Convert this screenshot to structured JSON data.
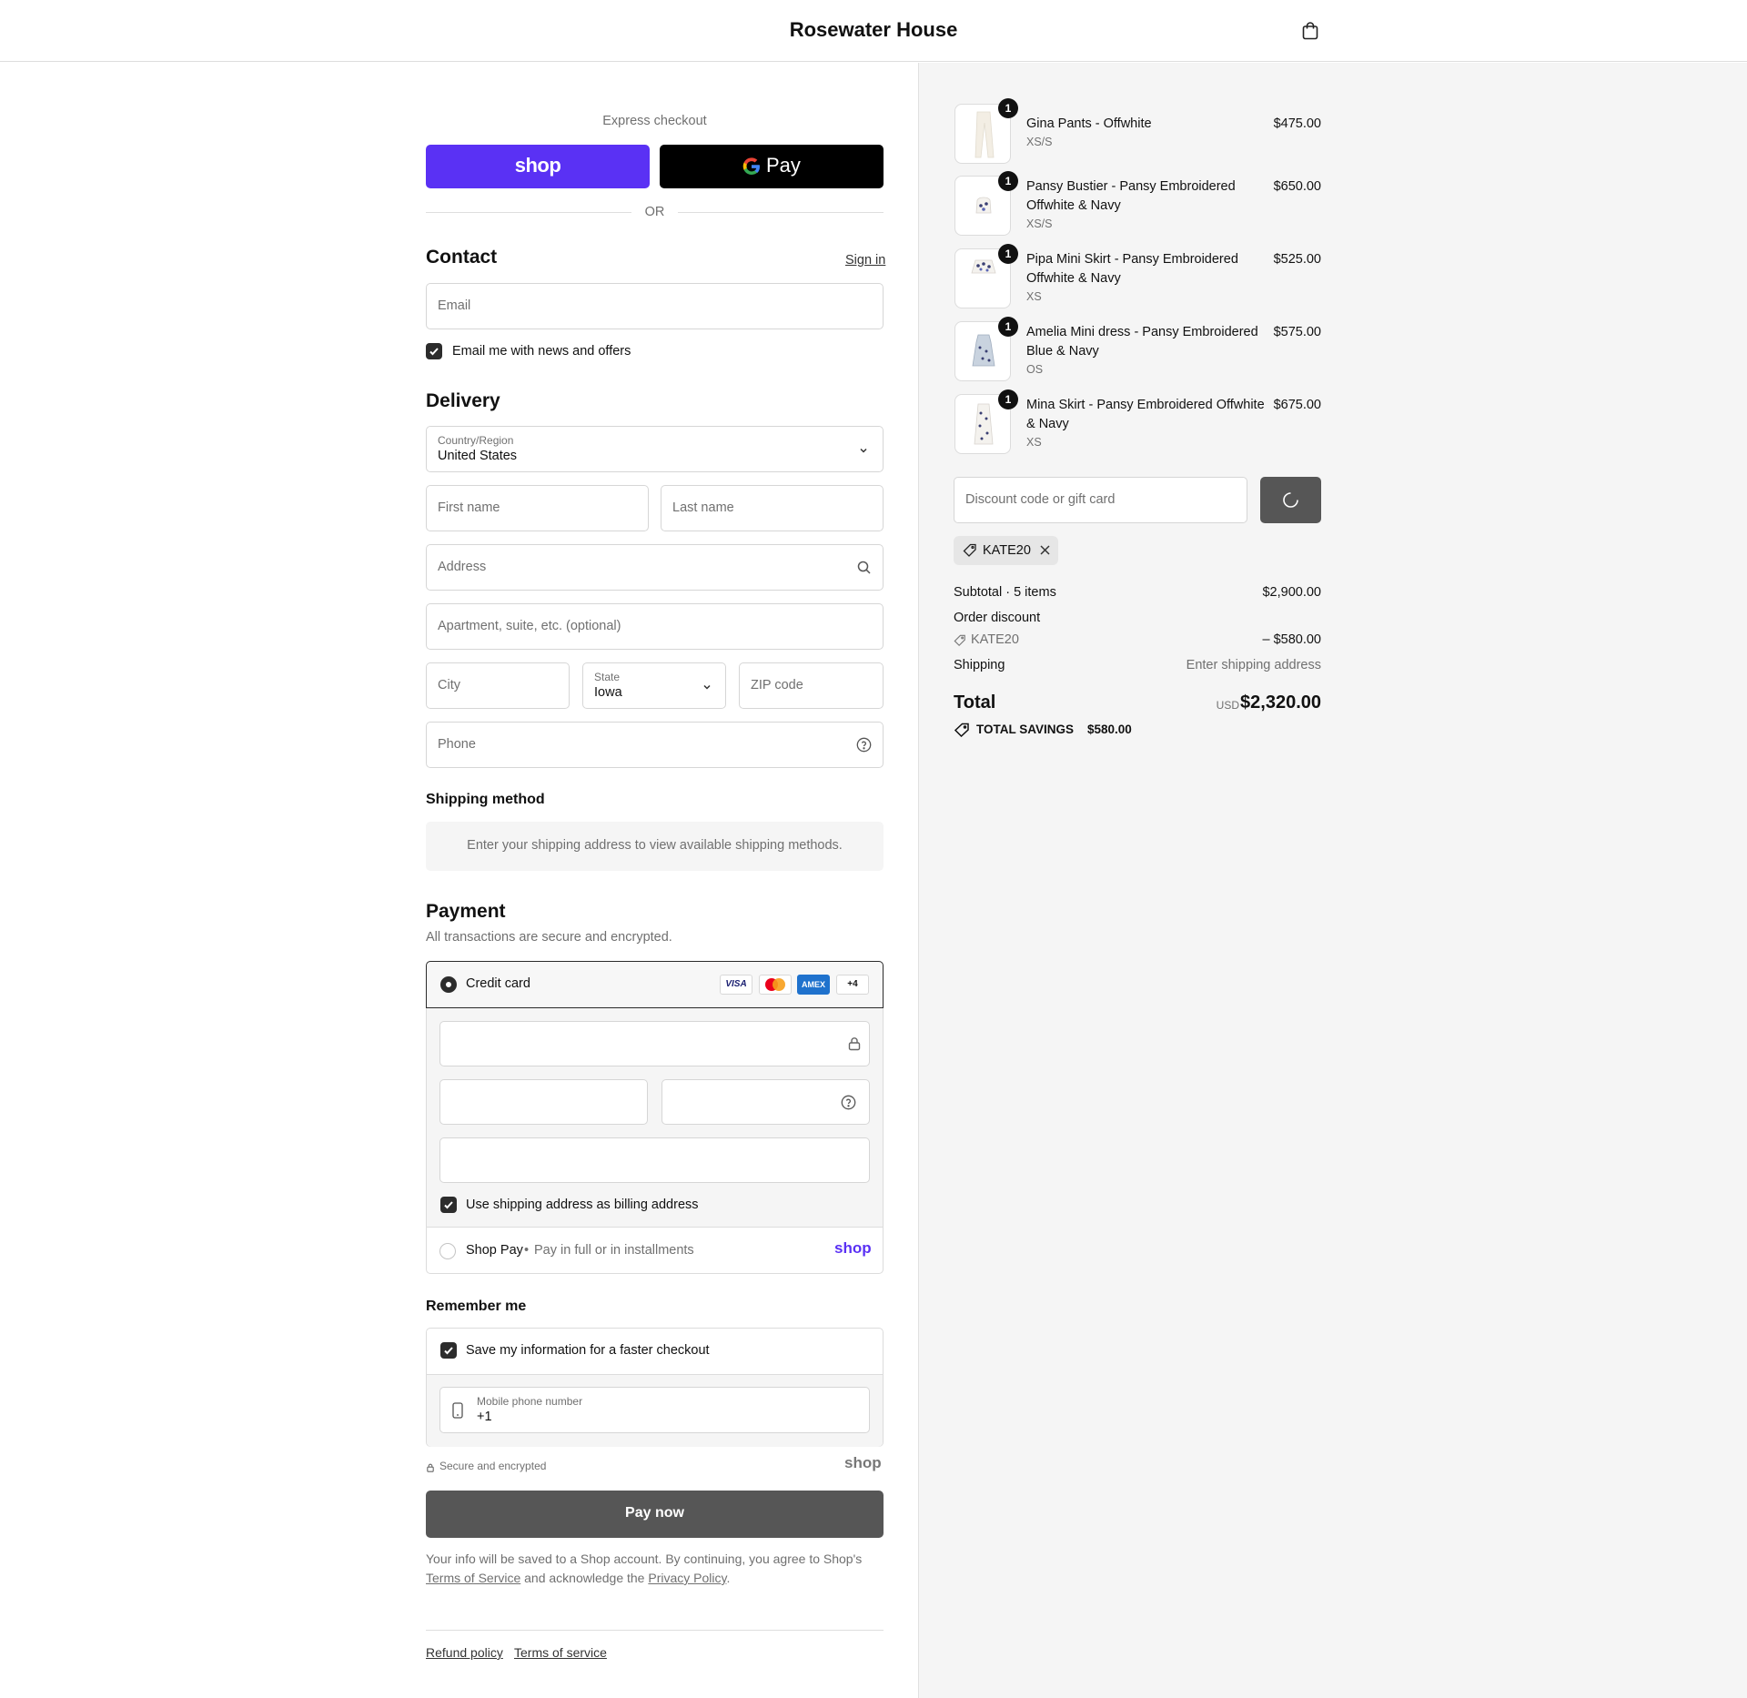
{
  "header": {
    "brand": "Rosewater House",
    "cart_icon": "shopping-bag-icon"
  },
  "express": {
    "title": "Express checkout",
    "shop_pay_label": "shop",
    "gpay_label": "Pay",
    "divider": "OR",
    "colors": {
      "shop": "#5a31f4",
      "gpay": "#000000"
    }
  },
  "contact": {
    "title": "Contact",
    "sign_in": "Sign in",
    "email_placeholder": "Email",
    "news_label": "Email me with news and offers"
  },
  "delivery": {
    "title": "Delivery",
    "country_label": "Country/Region",
    "country_value": "United States",
    "first_name": "First name",
    "last_name": "Last name",
    "address": "Address",
    "apartment": "Apartment, suite, etc. (optional)",
    "city": "City",
    "state_label": "State",
    "state_value": "Iowa",
    "zip": "ZIP code",
    "phone": "Phone"
  },
  "shipping_method": {
    "title": "Shipping method",
    "notice": "Enter your shipping address to view available shipping methods."
  },
  "payment": {
    "title": "Payment",
    "subtitle": "All transactions are secure and encrypted.",
    "credit_card": "Credit card",
    "cards": [
      "VISA",
      "MC",
      "AMEX",
      "+4"
    ],
    "billing_label": "Use shipping address as billing address",
    "shop_pay_label": "Shop Pay",
    "shop_pay_sep": "•",
    "shop_pay_desc": "Pay in full or in installments",
    "shop_pay_logo": "shop"
  },
  "remember": {
    "title": "Remember me",
    "save_label": "Save my information for a faster checkout",
    "mobile_label": "Mobile phone number",
    "mobile_value": "+1",
    "secure": "Secure and encrypted",
    "shop_logo": "shop"
  },
  "pay_button": "Pay now",
  "legal": {
    "line1": "Your info will be saved to a Shop account. By continuing, you agree to Shop's",
    "tos": "Terms of Service",
    "and": "and acknowledge the",
    "privacy": "Privacy Policy",
    "end": "."
  },
  "footer": {
    "refund": "Refund policy",
    "terms": "Terms of service"
  },
  "cart": {
    "items": [
      {
        "qty": "1",
        "name": "Gina Pants - Offwhite",
        "variant": "XS/S",
        "price": "$475.00"
      },
      {
        "qty": "1",
        "name": "Pansy Bustier - Pansy Embroidered Offwhite & Navy",
        "variant": "XS/S",
        "price": "$650.00"
      },
      {
        "qty": "1",
        "name": "Pipa Mini Skirt - Pansy Embroidered Offwhite & Navy",
        "variant": "XS",
        "price": "$525.00"
      },
      {
        "qty": "1",
        "name": "Amelia Mini dress - Pansy Embroidered Blue & Navy",
        "variant": "OS",
        "price": "$575.00"
      },
      {
        "qty": "1",
        "name": "Mina Skirt - Pansy Embroidered Offwhite & Navy",
        "variant": "XS",
        "price": "$675.00"
      }
    ],
    "discount_placeholder": "Discount code or gift card",
    "applied_code": "KATE20",
    "subtotal_label": "Subtotal · 5 items",
    "subtotal_value": "$2,900.00",
    "order_discount_label": "Order discount",
    "discount_code": "KATE20",
    "discount_value": "– $580.00",
    "shipping_label": "Shipping",
    "shipping_value": "Enter shipping address",
    "total_label": "Total",
    "currency": "USD",
    "total_value": "$2,320.00",
    "savings_label": "TOTAL SAVINGS",
    "savings_value": "$580.00"
  }
}
